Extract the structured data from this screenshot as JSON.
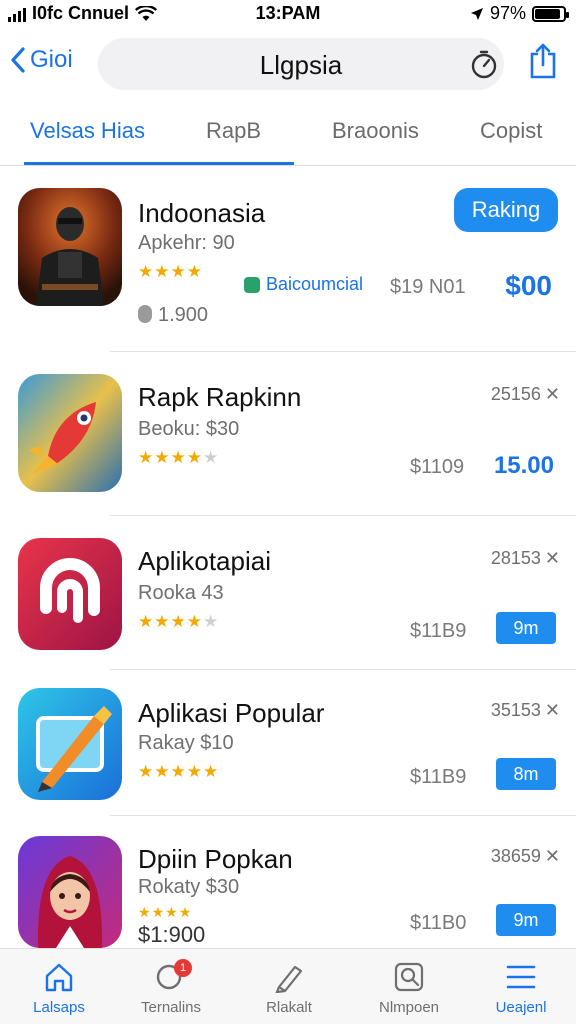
{
  "status": {
    "carrier": "I0fc Cnnuel",
    "time": "13:PAM",
    "battery_percent": 0.97,
    "battery_label": "97%"
  },
  "nav": {
    "back_label": "Gioi",
    "title": "Llgpsia"
  },
  "tabs": [
    {
      "label": "Velsas Hias",
      "active": true
    },
    {
      "label": "RapB",
      "active": false
    },
    {
      "label": "Braoonis",
      "active": false
    },
    {
      "label": "Copist",
      "active": false
    }
  ],
  "apps": [
    {
      "name": "Indoonasia",
      "sub": "Apkehr: 90",
      "rating": 4,
      "stars_total": 4,
      "downloads": "1.900",
      "action_label": "Raking",
      "badge": "Baicoumcial",
      "price_gray": "$19 N01",
      "price_blue": "$00"
    },
    {
      "name": "Rapk Rapkinn",
      "sub": "Beoku: $30",
      "rating": 4,
      "stars_total": 5,
      "count": "25156",
      "price_gray": "$1109",
      "price_blue": "15.00"
    },
    {
      "name": "Aplikotapiai",
      "sub": "Rooka 43",
      "rating": 4,
      "stars_total": 5,
      "count": "28153",
      "price_gray": "$11B9",
      "button_label": "9m"
    },
    {
      "name": "Aplikasi Popular",
      "sub": "Rakay $10",
      "rating": 5,
      "stars_total": 5,
      "count": "35153",
      "price_gray": "$11B9",
      "button_label": "8m"
    },
    {
      "name": "Dpiin Popkan",
      "sub": "Rokaty $30",
      "rating": 4,
      "stars_total": 4,
      "count": "38659",
      "price_text": "$1:900",
      "price_gray": "$11B0",
      "button_label": "9m"
    }
  ],
  "tabbar": [
    {
      "label": "Lalsaps",
      "active": true
    },
    {
      "label": "Ternalins",
      "active": false,
      "badge": "1"
    },
    {
      "label": "Rlakalt",
      "active": false
    },
    {
      "label": "Nlmpoen",
      "active": false
    },
    {
      "label": "Ueajenl",
      "active": true
    }
  ],
  "colors": {
    "accent": "#1a73e8",
    "button": "#1f8cf0",
    "star": "#f2a900"
  }
}
